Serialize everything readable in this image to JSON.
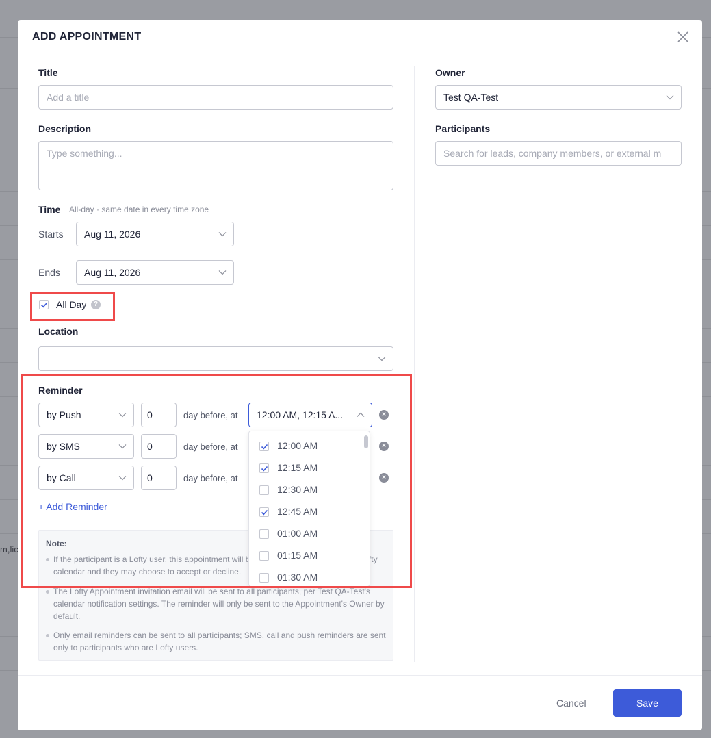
{
  "background": {
    "fragment_text": "m,lic"
  },
  "modal": {
    "title": "ADD APPOINTMENT"
  },
  "form": {
    "title_label": "Title",
    "title_placeholder": "Add a title",
    "description_label": "Description",
    "description_placeholder": "Type something...",
    "time_label": "Time",
    "time_hint": "All-day · same date in every time zone",
    "starts_label": "Starts",
    "starts_value": "Aug 11, 2026",
    "ends_label": "Ends",
    "ends_value": "Aug 11, 2026",
    "all_day_label": "All Day",
    "all_day_checked": true,
    "help_glyph": "?",
    "location_label": "Location",
    "location_value": "",
    "owner_label": "Owner",
    "owner_value": "Test QA-Test",
    "participants_label": "Participants",
    "participants_placeholder": "Search for leads, company members, or external m"
  },
  "reminder": {
    "label": "Reminder",
    "rows": [
      {
        "method": "by Push",
        "days": "0",
        "connector": "day before, at",
        "time": "12:00 AM, 12:15 A..."
      },
      {
        "method": "by SMS",
        "days": "0",
        "connector": "day before, at"
      },
      {
        "method": "by Call",
        "days": "0",
        "connector": "day before, at"
      }
    ],
    "remove_glyph": "×",
    "add_label": "+ Add Reminder"
  },
  "time_dropdown": {
    "options": [
      {
        "label": "12:00 AM",
        "checked": true
      },
      {
        "label": "12:15 AM",
        "checked": true
      },
      {
        "label": "12:30 AM",
        "checked": false
      },
      {
        "label": "12:45 AM",
        "checked": true
      },
      {
        "label": "01:00 AM",
        "checked": false
      },
      {
        "label": "01:15 AM",
        "checked": false
      },
      {
        "label": "01:30 AM",
        "checked": false
      }
    ]
  },
  "note": {
    "title": "Note:",
    "items": [
      "If the participant is a Lofty user, this appointment will be automatically added to their Lofty calendar and they may choose to accept or decline.",
      "The Lofty Appointment invitation email will be sent to all participants, per Test QA-Test's calendar notification settings. The reminder will only be sent to the Appointment's Owner by default.",
      "Only email reminders can be sent to all participants; SMS, call and push reminders are sent only to participants who are Lofty users."
    ]
  },
  "footer": {
    "cancel_label": "Cancel",
    "save_label": "Save"
  },
  "colors": {
    "accent": "#3d5bd9",
    "highlight": "#ef4a4a",
    "overlay": "#9a9ca2"
  }
}
